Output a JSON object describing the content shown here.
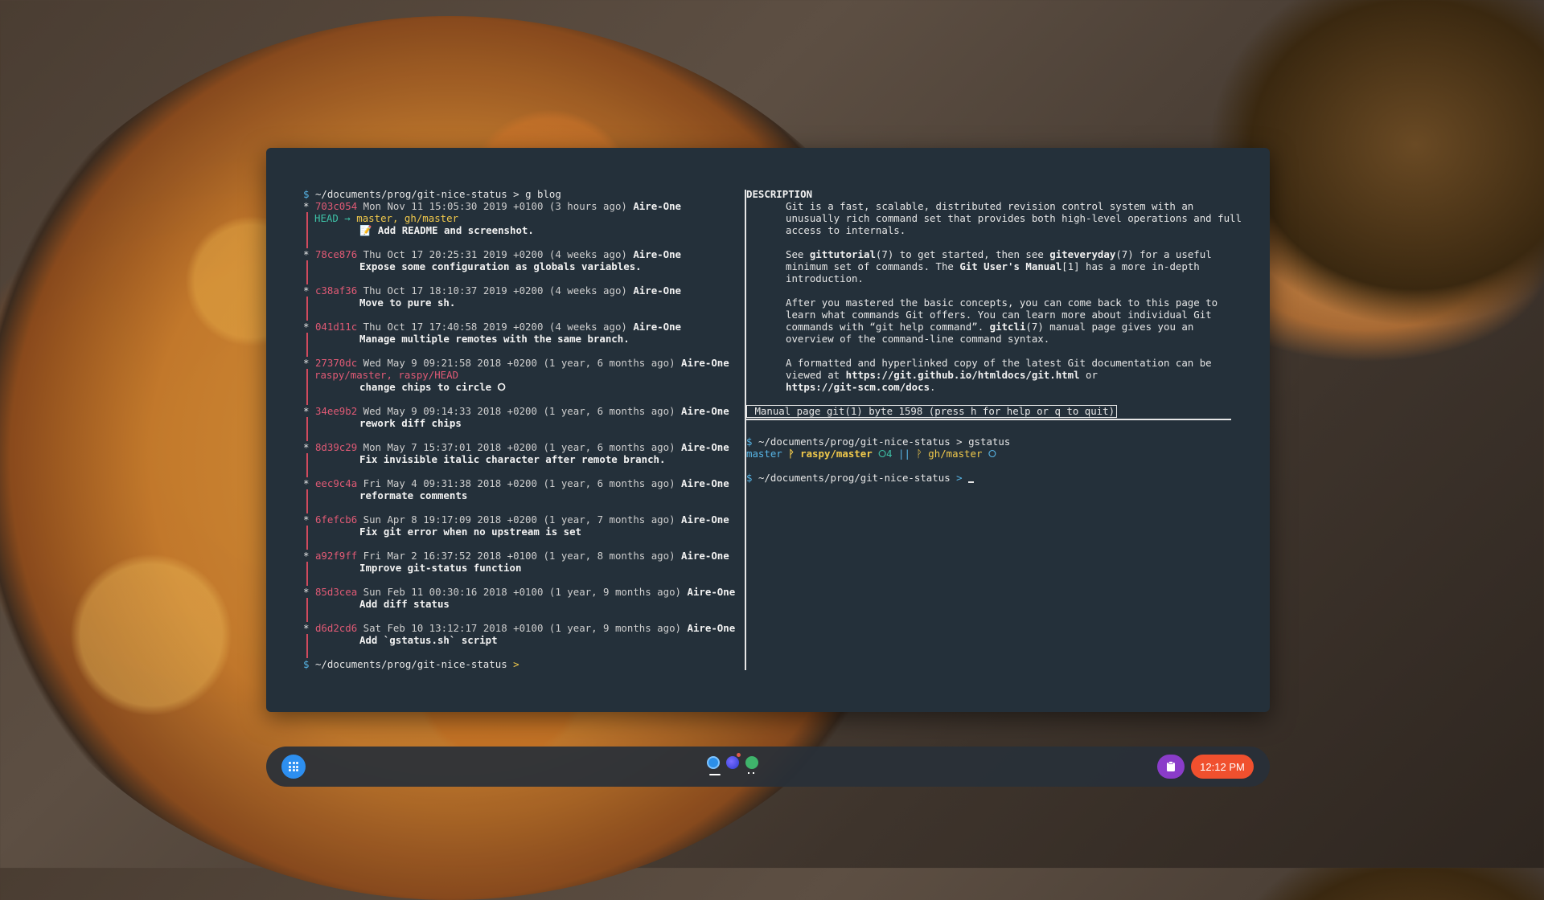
{
  "blog": {
    "cmd_path": "~/documents/prog/git-nice-status",
    "cmd": "g blog",
    "commits": [
      {
        "hash": "703c054",
        "date": "Mon Nov 11 15:05:30 2019 +0100",
        "rel": "(3 hours ago)",
        "author": "Aire-One",
        "refs_head": "HEAD →",
        "refs": "master, gh/master",
        "refs_color": "green",
        "msg": "📝 Add README and screenshot."
      },
      {
        "hash": "78ce876",
        "date": "Thu Oct 17 20:25:31 2019 +0200",
        "rel": "(4 weeks ago)",
        "author": "Aire-One",
        "msg": "Expose some configuration as globals variables."
      },
      {
        "hash": "c38af36",
        "date": "Thu Oct 17 18:10:37 2019 +0200",
        "rel": "(4 weeks ago)",
        "author": "Aire-One",
        "msg": "Move to pure sh."
      },
      {
        "hash": "041d11c",
        "date": "Thu Oct 17 17:40:58 2019 +0200",
        "rel": "(4 weeks ago)",
        "author": "Aire-One",
        "msg": "Manage multiple remotes with the same branch."
      },
      {
        "hash": "27370dc",
        "date": "Wed May 9 09:21:58 2018 +0200",
        "rel": "(1 year, 6 months ago)",
        "author": "Aire-One",
        "refs": "raspy/master, raspy/HEAD",
        "refs_color": "red",
        "msg": "change chips to circle ⭘"
      },
      {
        "hash": "34ee9b2",
        "date": "Wed May 9 09:14:33 2018 +0200",
        "rel": "(1 year, 6 months ago)",
        "author": "Aire-One",
        "msg": "rework diff chips"
      },
      {
        "hash": "8d39c29",
        "date": "Mon May 7 15:37:01 2018 +0200",
        "rel": "(1 year, 6 months ago)",
        "author": "Aire-One",
        "msg": "Fix invisible italic character after remote branch."
      },
      {
        "hash": "eec9c4a",
        "date": "Fri May 4 09:31:38 2018 +0200",
        "rel": "(1 year, 6 months ago)",
        "author": "Aire-One",
        "msg": "reformate comments"
      },
      {
        "hash": "6fefcb6",
        "date": "Sun Apr 8 19:17:09 2018 +0200",
        "rel": "(1 year, 7 months ago)",
        "author": "Aire-One",
        "msg": "Fix git error when no upstream is set"
      },
      {
        "hash": "a92f9ff",
        "date": "Fri Mar 2 16:37:52 2018 +0100",
        "rel": "(1 year, 8 months ago)",
        "author": "Aire-One",
        "msg": "Improve git-status function"
      },
      {
        "hash": "85d3cea",
        "date": "Sun Feb 11 00:30:16 2018 +0100",
        "rel": "(1 year, 9 months ago)",
        "author": "Aire-One",
        "msg": "Add diff status"
      },
      {
        "hash": "d6d2cd6",
        "date": "Sat Feb 10 13:12:17 2018 +0100",
        "rel": "(1 year, 9 months ago)",
        "author": "Aire-One",
        "msg": "Add `gstatus.sh` script"
      }
    ],
    "final_prompt_path": "~/documents/prog/git-nice-status",
    "final_prompt_caret": ">"
  },
  "man": {
    "heading": "DESCRIPTION",
    "p1": [
      "Git is a fast, scalable, distributed revision control system with an",
      "unusually rich command set that provides both high-level operations and full",
      "access to internals."
    ],
    "p2_l1_a": "See ",
    "p2_l1_b": "gittutorial",
    "p2_l1_c": "(7) to get started, then see ",
    "p2_l1_d": "giteveryday",
    "p2_l1_e": "(7) for a useful",
    "p2_l2_a": "minimum set of commands. The ",
    "p2_l2_b": "Git User's Manual",
    "p2_l2_c": "[1] has a more in-depth",
    "p2_l3": "introduction.",
    "p3_l1": "After you mastered the basic concepts, you can come back to this page to",
    "p3_l2": "learn what commands Git offers. You can learn more about individual Git",
    "p3_l3_a": "commands with “git help command”. ",
    "p3_l3_b": "gitcli",
    "p3_l3_c": "(7) manual page gives you an",
    "p3_l4": "overview of the command-line command syntax.",
    "p4_l1": "A formatted and hyperlinked copy of the latest Git documentation can be",
    "p4_l2_a": "viewed at ",
    "p4_l2_b": "https://git.github.io/htmldocs/git.html",
    "p4_l2_c": " or",
    "p4_l3_b": "https://git-scm.com/docs",
    "p4_l3_c": ".",
    "status_bar": " Manual page git(1) byte 1598 (press h for help or q to quit)"
  },
  "gstatus": {
    "path": "~/documents/prog/git-nice-status",
    "cmd": "gstatus",
    "local_branch": "master",
    "raspy": "raspy/master",
    "raspy_count": "⭘4",
    "sep": "||",
    "gh": "gh/master",
    "gh_mark": "⭘",
    "next_path": "~/documents/prog/git-nice-status",
    "caret": ">"
  },
  "prompt": {
    "dollar": "$",
    "gt": ">",
    "star": "*"
  },
  "taskbar": {
    "clock": "12:12 PM",
    "colors": {
      "launcher": "#2d8ff0",
      "tray": "#8a3cc9",
      "clock": "#f0502e"
    }
  }
}
